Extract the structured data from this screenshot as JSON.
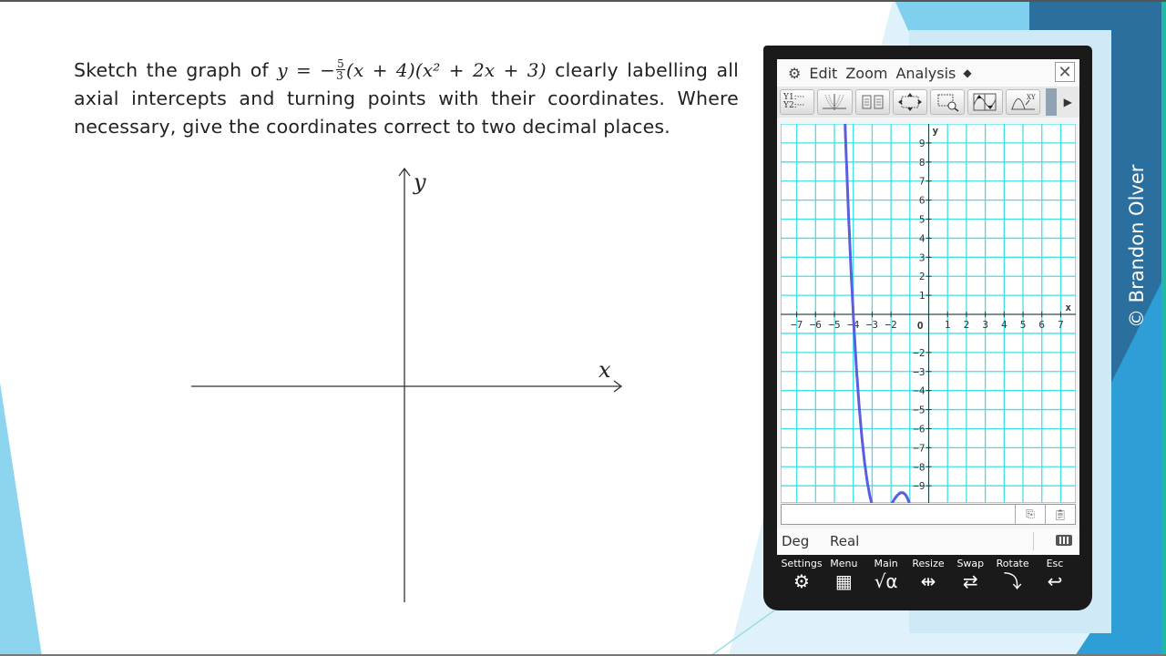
{
  "slide": {
    "question": {
      "part1": "Sketch the graph of ",
      "eq_lhs": "y = −",
      "frac_num": "5",
      "frac_den": "3",
      "eq_rhs": "(x + 4)(x² + 2x + 3)",
      "part2": " clearly labelling all axial intercepts and turning points with their coordinates. Where necessary, give the coordinates correct to two decimal places."
    },
    "sketch_axes": {
      "x_label": "x",
      "y_label": "y"
    },
    "watermark": "© Brandon Olver",
    "colors": {
      "accent_light": "#7fd0ee",
      "accent_mid": "#2e9fd6",
      "accent_dark": "#2b6f9f",
      "teal_edge": "#1fb9a5"
    }
  },
  "calculator": {
    "menu": {
      "gear_icon": "gear-icon",
      "items": [
        "Edit",
        "Zoom",
        "Analysis"
      ],
      "diamond": "◆",
      "close": "✕"
    },
    "toolbar": {
      "buttons": [
        {
          "name": "graph-editor",
          "label_line1": "Y1:···",
          "label_line2": "Y2:···"
        },
        {
          "name": "graph-family"
        },
        {
          "name": "table"
        },
        {
          "name": "pan"
        },
        {
          "name": "zoom-box"
        },
        {
          "name": "split-view"
        },
        {
          "name": "trace"
        }
      ],
      "next": "▶"
    },
    "graph": {
      "x_ticks": [
        "−7",
        "−6",
        "−5",
        "−4",
        "−3",
        "−2",
        "1",
        "2",
        "3",
        "4",
        "5",
        "6",
        "7"
      ],
      "y_ticks_pos": [
        "1",
        "2",
        "3",
        "4",
        "5",
        "6",
        "7",
        "8",
        "9"
      ],
      "y_ticks_neg": [
        "−2",
        "−3",
        "−4",
        "−5",
        "−6",
        "−7",
        "−8",
        "−9"
      ],
      "origin_label": "O",
      "x_axis_label": "x",
      "y_axis_label": "y",
      "view": {
        "xmin": -7.85,
        "xmax": 7.8,
        "ymin": -9.9,
        "ymax": 10.0
      },
      "function": {
        "a": -1.6667,
        "factors": "(x+4)(x^2+2x+3)"
      },
      "curve_color": "#5a5ee0",
      "grid_color": "#3fe0e8"
    },
    "status": {
      "angle": "Deg",
      "mode": "Real"
    },
    "softkeys": [
      {
        "label": "Settings",
        "icon": "⚙"
      },
      {
        "label": "Menu",
        "icon": "▦"
      },
      {
        "label": "Main",
        "icon": "√α"
      },
      {
        "label": "Resize",
        "icon": "⇹"
      },
      {
        "label": "Swap",
        "icon": "⇄"
      },
      {
        "label": "Rotate",
        "icon": "⤵"
      },
      {
        "label": "Esc",
        "icon": "↩"
      }
    ]
  }
}
